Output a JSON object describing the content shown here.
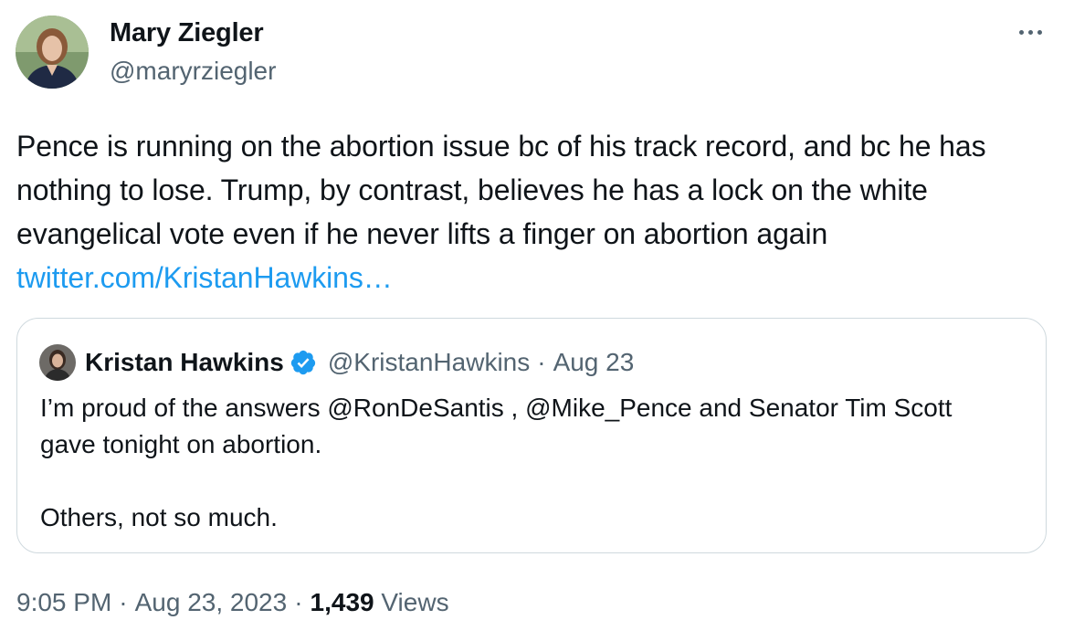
{
  "author": {
    "display_name": "Mary Ziegler",
    "handle": "@maryrziegler",
    "avatar_icon": "profile-photo"
  },
  "more_icon": "more-horizontal-icon",
  "tweet": {
    "text": "Pence is running on the abortion issue bc of his track record, and bc he has nothing to lose. Trump, by contrast, believes he has a lock on the white evangelical vote even if he never lifts a finger on abortion again",
    "link_text": "twitter.com/KristanHawkins…"
  },
  "quoted_tweet": {
    "display_name": "Kristan Hawkins",
    "verified_icon": "verified-badge-icon",
    "handle": "@KristanHawkins",
    "separator": "·",
    "date": "Aug 23",
    "text": "I’m proud of the answers @RonDeSantis , @Mike_Pence  and Senator Tim Scott gave tonight on abortion.\n\nOthers, not so much."
  },
  "meta": {
    "time": "9:05 PM",
    "separator": "·",
    "date": "Aug 23, 2023",
    "views_count": "1,439",
    "views_label": "Views"
  },
  "colors": {
    "link": "#1d9bf0",
    "secondary_text": "#536471",
    "primary_text": "#0f1419",
    "border": "#cfd9de",
    "verified": "#1d9bf0"
  }
}
